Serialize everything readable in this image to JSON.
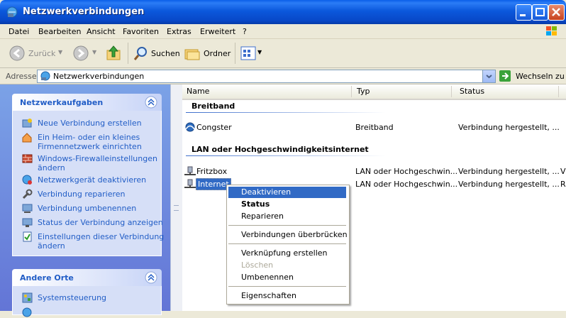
{
  "window": {
    "title": "Netzwerkverbindungen"
  },
  "menu": [
    "Datei",
    "Bearbeiten",
    "Ansicht",
    "Favoriten",
    "Extras",
    "Erweitert",
    "?"
  ],
  "toolbar": {
    "back": "Zurück",
    "search": "Suchen",
    "folders": "Ordner"
  },
  "address": {
    "label": "Adresse",
    "value": "Netzwerkverbindungen",
    "go": "Wechseln zu"
  },
  "tasks": {
    "title": "Netzwerkaufgaben",
    "items": [
      {
        "label": "Neue Verbindung erstellen"
      },
      {
        "label": "Ein Heim- oder ein kleines",
        "label2": "Firmennetzwerk einrichten"
      },
      {
        "label": "Windows-Firewalleinstellungen",
        "label2": "ändern"
      },
      {
        "label": "Netzwerkgerät deaktivieren"
      },
      {
        "label": "Verbindung reparieren"
      },
      {
        "label": "Verbindung umbenennen"
      },
      {
        "label": "Status der Verbindung anzeigen"
      },
      {
        "label": "Einstellungen dieser Verbindung",
        "label2": "ändern"
      }
    ]
  },
  "other": {
    "title": "Andere Orte",
    "items": [
      {
        "label": "Systemsteuerung"
      }
    ]
  },
  "columns": {
    "name": "Name",
    "type": "Typ",
    "status": "Status"
  },
  "groups": [
    {
      "title": "Breitband",
      "rows": [
        {
          "name": "Congster",
          "type": "Breitband",
          "status": "Verbindung hergestellt, ..."
        }
      ]
    },
    {
      "title": "LAN oder Hochgeschwindigkeitsinternet",
      "rows": [
        {
          "name": "Fritzbox",
          "type": "LAN oder Hochgeschwin...",
          "status": "Verbindung hergestellt, ...",
          "extra": "V"
        },
        {
          "name": "Internet",
          "type": "LAN oder Hochgeschwin...",
          "status": "Verbindung hergestellt, ...",
          "extra": "R"
        }
      ]
    }
  ],
  "context_menu": [
    "Deaktivieren",
    "Status",
    "Reparieren",
    "Verbindungen überbrücken",
    "Verknüpfung erstellen",
    "Löschen",
    "Umbenennen",
    "Eigenschaften"
  ],
  "colors": {
    "title_bar": "#0a5ee8",
    "selection": "#316ac5",
    "task_link": "#215dc6"
  }
}
